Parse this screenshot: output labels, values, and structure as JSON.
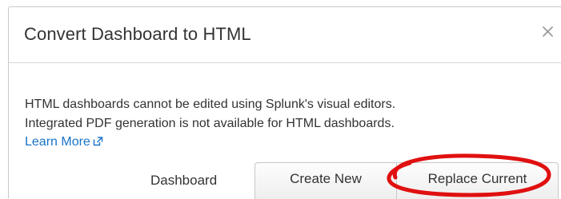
{
  "dialog": {
    "title": "Convert Dashboard to HTML",
    "close_icon": "close-icon",
    "message_line1": "HTML dashboards cannot be edited using Splunk's visual editors.",
    "message_line2": "Integrated PDF generation is not available for HTML dashboards.",
    "learn_more_label": "Learn More",
    "learn_more_icon": "external-link-icon",
    "dashboard_label": "Dashboard",
    "options": [
      {
        "label": "Create New"
      },
      {
        "label": "Replace Current"
      }
    ]
  },
  "colors": {
    "title_text": "#333333",
    "link": "#1a73c8",
    "annotation": "#e01010"
  }
}
